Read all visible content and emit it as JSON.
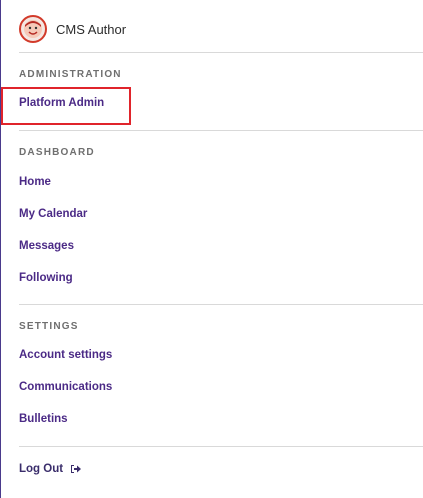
{
  "user": {
    "name": "CMS Author",
    "avatar_icon": "avatar-icon"
  },
  "sections": {
    "administration": {
      "heading": "ADMINISTRATION",
      "items": [
        "Platform Admin"
      ]
    },
    "dashboard": {
      "heading": "DASHBOARD",
      "items": [
        "Home",
        "My Calendar",
        "Messages",
        "Following"
      ]
    },
    "settings": {
      "heading": "SETTINGS",
      "items": [
        "Account settings",
        "Communications",
        "Bulletins"
      ]
    }
  },
  "logout": {
    "label": "Log Out",
    "icon": "sign-out-icon"
  },
  "colors": {
    "link": "#4b2a86",
    "highlight": "#e0242b",
    "heading": "#6f6f6f"
  }
}
